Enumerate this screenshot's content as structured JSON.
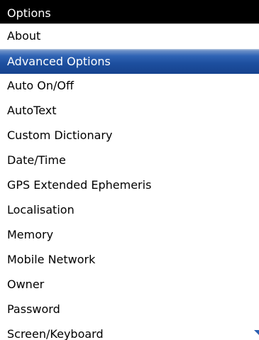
{
  "header": {
    "title": "Options"
  },
  "menu": {
    "selected_index": 1,
    "items": [
      {
        "label": "About"
      },
      {
        "label": "Advanced Options"
      },
      {
        "label": "Auto On/Off"
      },
      {
        "label": "AutoText"
      },
      {
        "label": "Custom Dictionary"
      },
      {
        "label": "Date/Time"
      },
      {
        "label": "GPS Extended Ephemeris"
      },
      {
        "label": "Localisation"
      },
      {
        "label": "Memory"
      },
      {
        "label": "Mobile Network"
      },
      {
        "label": "Owner"
      },
      {
        "label": "Password"
      },
      {
        "label": "Screen/Keyboard"
      }
    ]
  },
  "colors": {
    "title_bar_background": "#000000",
    "selection_highlight": "#1d4f9f",
    "scroll_indicator": "#2a5fb0"
  },
  "icons": {
    "scroll_indicator": "scroll-down-arrow-icon"
  }
}
